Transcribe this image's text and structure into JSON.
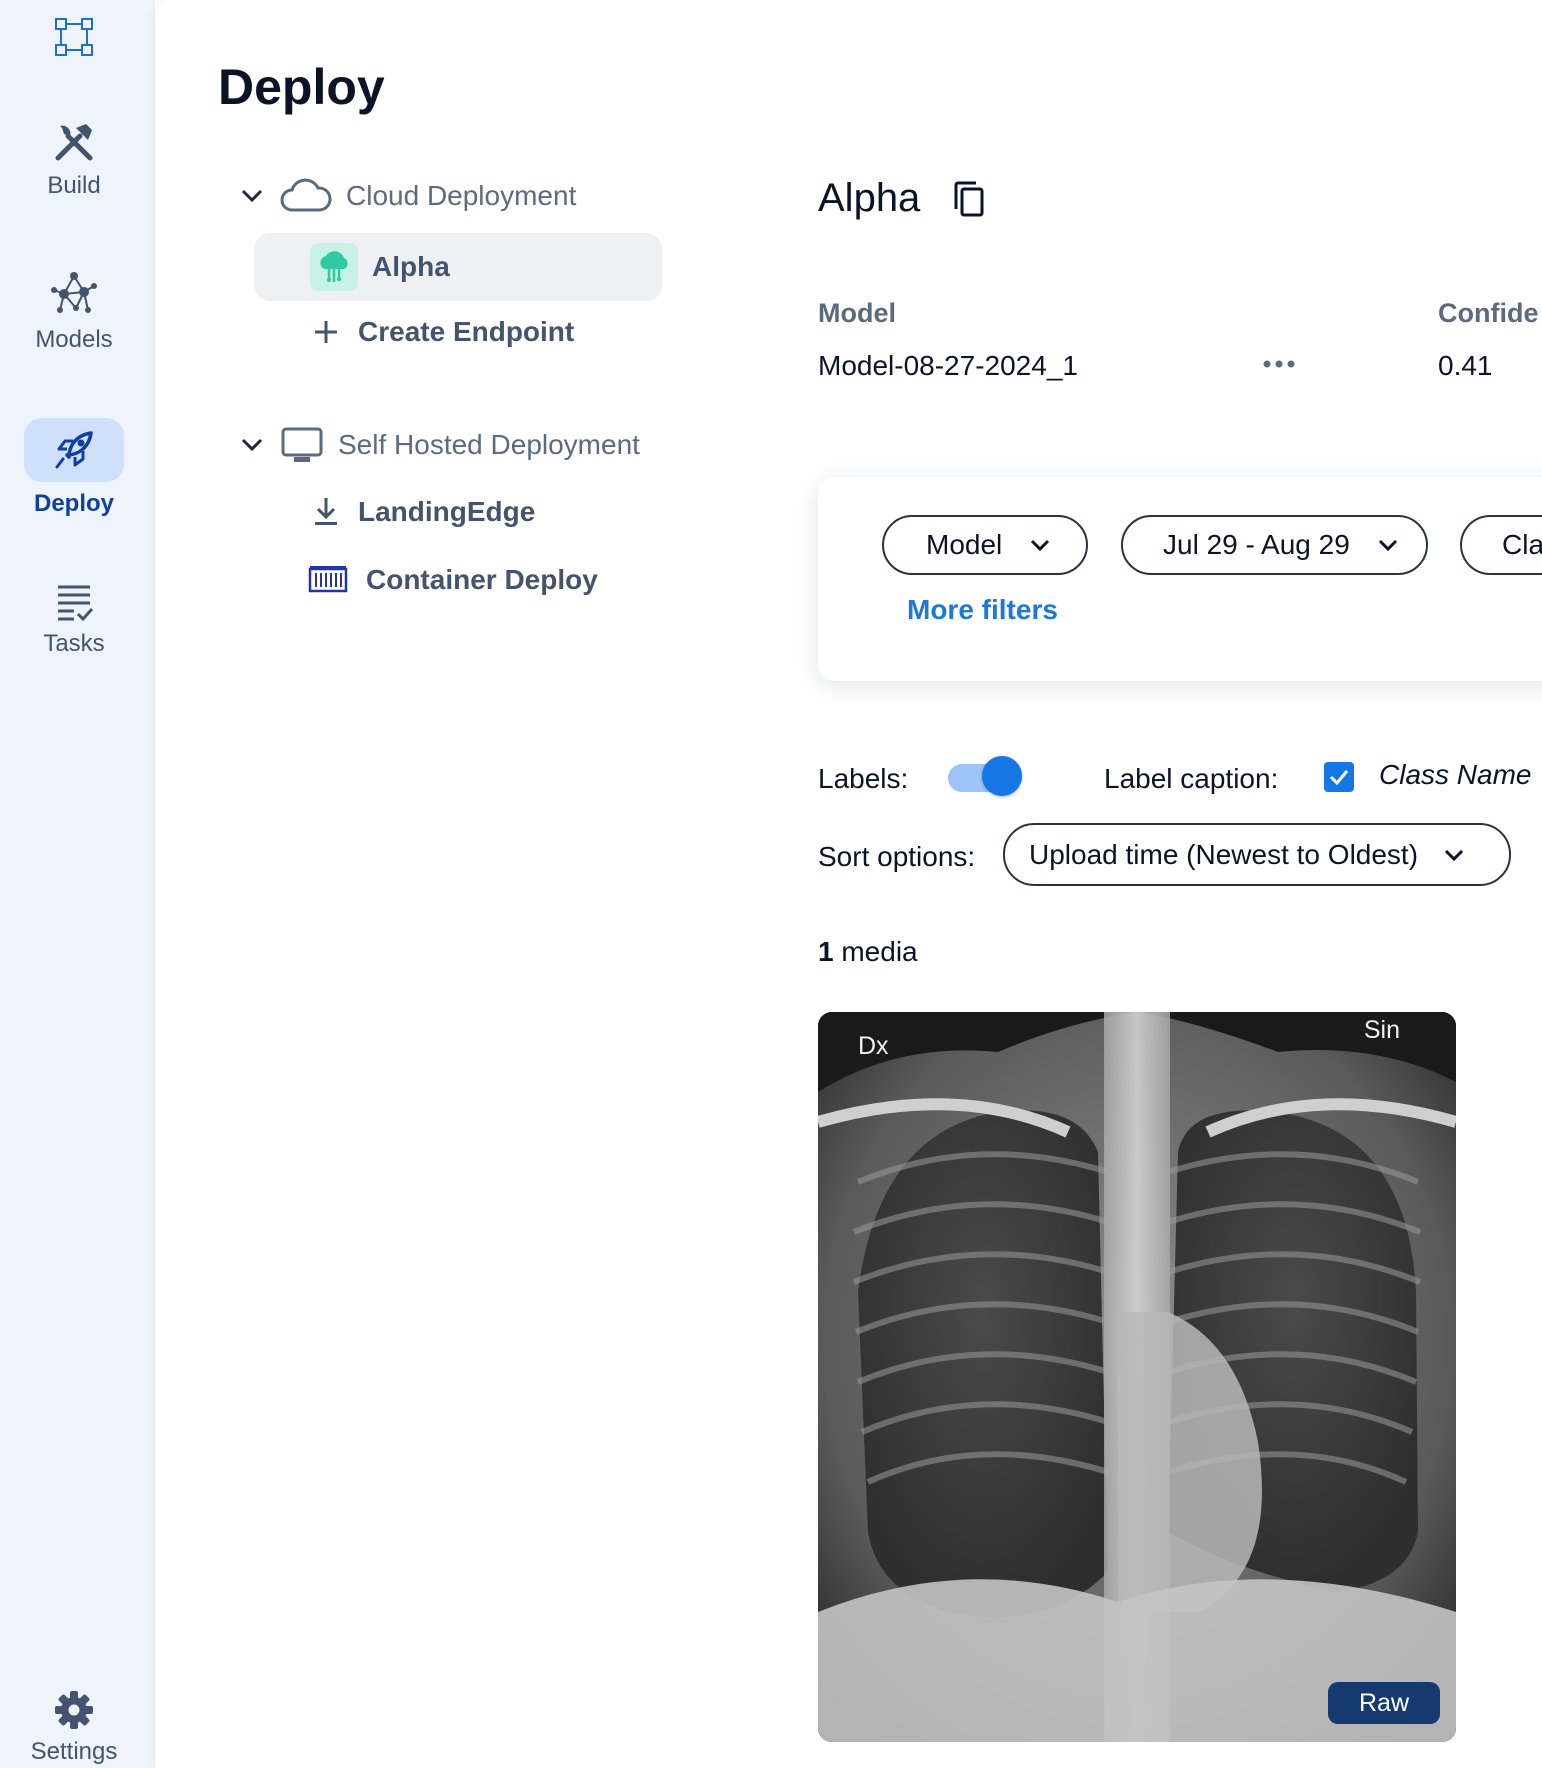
{
  "nav": {
    "items": [
      {
        "label": "Build",
        "icon": "build-tools-icon"
      },
      {
        "label": "Models",
        "icon": "models-network-icon"
      },
      {
        "label": "Deploy",
        "icon": "rocket-icon",
        "active": true
      },
      {
        "label": "Tasks",
        "icon": "tasks-list-icon"
      }
    ],
    "settings_label": "Settings",
    "logo_icon": "logo-frame-icon"
  },
  "page": {
    "title": "Deploy"
  },
  "tree": {
    "cloud": {
      "label": "Cloud Deployment",
      "endpoints": [
        {
          "label": "Alpha",
          "selected": true
        }
      ],
      "create_label": "Create Endpoint"
    },
    "self_hosted": {
      "label": "Self Hosted Deployment",
      "items": [
        {
          "label": "LandingEdge",
          "icon": "download-icon"
        },
        {
          "label": "Container Deploy",
          "icon": "container-icon"
        }
      ]
    }
  },
  "endpoint": {
    "name": "Alpha",
    "model_heading": "Model",
    "model_value": "Model-08-27-2024_1",
    "confidence_heading": "Confide",
    "confidence_value": "0.41"
  },
  "filters": {
    "model_label": "Model",
    "date_label": "Jul 29 - Aug 29",
    "class_label": "Cla",
    "more_filters": "More filters"
  },
  "controls": {
    "labels_label": "Labels:",
    "labels_on": true,
    "caption_label": "Label caption:",
    "caption_checked": true,
    "caption_value": "Class Name",
    "sort_label": "Sort options:",
    "sort_value": "Upload time (Newest to Oldest)"
  },
  "media": {
    "count": "1",
    "count_suffix": "media",
    "badge": "Raw",
    "image_text_left": "Dx",
    "image_text_right": "Sin"
  },
  "colors": {
    "accent": "#1576e6",
    "nav_active_bg": "#cfe0fb",
    "rail_bg": "#eef3fc",
    "badge_bg": "#163a70"
  }
}
